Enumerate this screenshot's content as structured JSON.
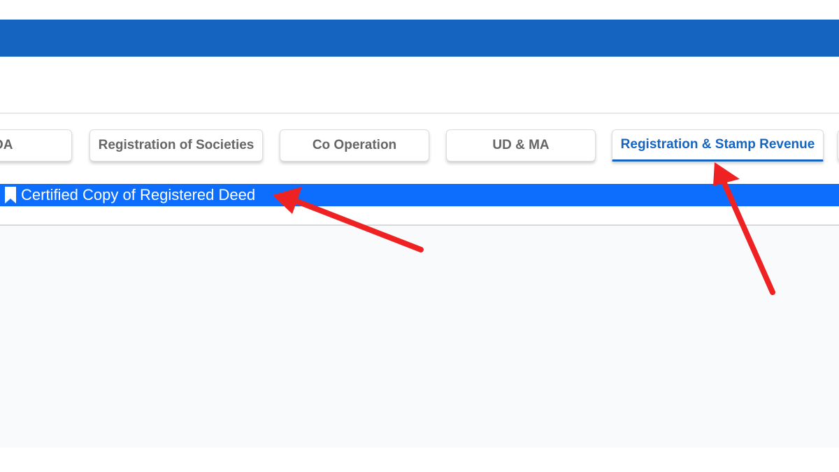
{
  "tabs": [
    {
      "label": "DA",
      "active": false
    },
    {
      "label": "Registration of Societies",
      "active": false
    },
    {
      "label": "Co Operation",
      "active": false
    },
    {
      "label": "UD & MA",
      "active": false
    },
    {
      "label": "Registration & Stamp Revenue",
      "active": true
    }
  ],
  "sub_menu": {
    "icon": "bookmark-icon",
    "item_label": "Certified Copy of Registered Deed"
  },
  "colors": {
    "header_blue": "#1565c0",
    "submenu_blue": "#0d6efd",
    "active_tab_text": "#1565c0",
    "inactive_tab_text": "#666666",
    "annotation_arrow": "#ee2222"
  }
}
